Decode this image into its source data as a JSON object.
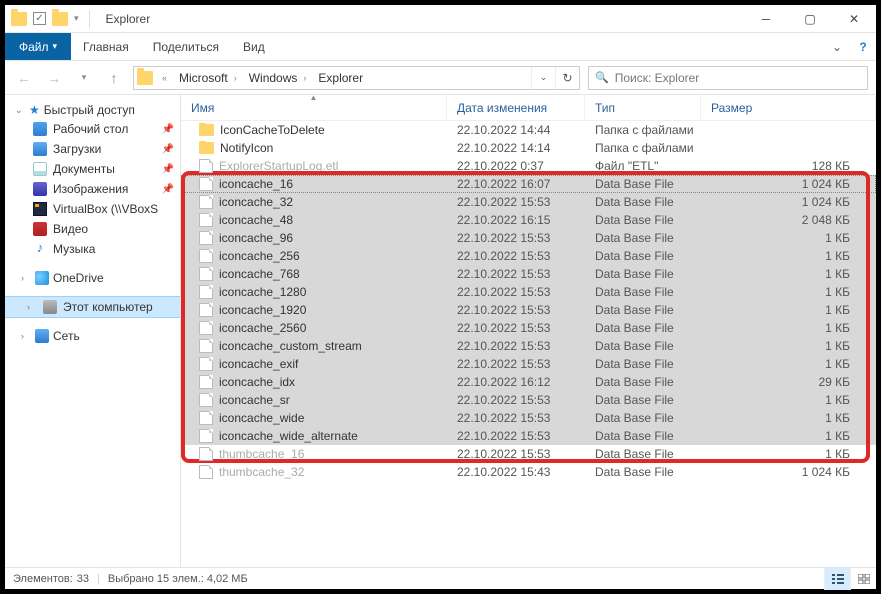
{
  "window": {
    "title": "Explorer",
    "tabs": {
      "file": "Файл",
      "home": "Главная",
      "share": "Поделиться",
      "view": "Вид"
    }
  },
  "nav": {
    "crumbs": [
      "Microsoft",
      "Windows",
      "Explorer"
    ],
    "search_placeholder": "Поиск: Explorer"
  },
  "sidebar": {
    "quick": "Быстрый доступ",
    "items": [
      {
        "label": "Рабочий стол",
        "pin": true,
        "ic": "ic-desktop"
      },
      {
        "label": "Загрузки",
        "pin": true,
        "ic": "ic-download"
      },
      {
        "label": "Документы",
        "pin": true,
        "ic": "ic-docs"
      },
      {
        "label": "Изображения",
        "pin": true,
        "ic": "ic-pics"
      },
      {
        "label": "VirtualBox (\\\\VBoxS",
        "pin": false,
        "ic": "ic-vbox"
      },
      {
        "label": "Видео",
        "pin": false,
        "ic": "ic-vid"
      },
      {
        "label": "Музыка",
        "pin": false,
        "ic": "ic-music"
      }
    ],
    "onedrive": "OneDrive",
    "thispc": "Этот компьютер",
    "network": "Сеть"
  },
  "columns": {
    "name": "Имя",
    "date": "Дата изменения",
    "type": "Тип",
    "size": "Размер"
  },
  "files": [
    {
      "name": "IconCacheToDelete",
      "date": "22.10.2022 14:44",
      "type": "Папка с файлами",
      "size": "",
      "icon": "folder",
      "selected": false
    },
    {
      "name": "NotifyIcon",
      "date": "22.10.2022 14:14",
      "type": "Папка с файлами",
      "size": "",
      "icon": "folder",
      "selected": false
    },
    {
      "name": "ExplorerStartupLog.etl",
      "date": "22.10.2022 0:37",
      "type": "Файл \"ETL\"",
      "size": "128 КБ",
      "icon": "file",
      "selected": false,
      "faded": true
    },
    {
      "name": "iconcache_16",
      "date": "22.10.2022 16:07",
      "type": "Data Base File",
      "size": "1 024 КБ",
      "icon": "file",
      "selected": true,
      "dotted": true
    },
    {
      "name": "iconcache_32",
      "date": "22.10.2022 15:53",
      "type": "Data Base File",
      "size": "1 024 КБ",
      "icon": "file",
      "selected": true
    },
    {
      "name": "iconcache_48",
      "date": "22.10.2022 16:15",
      "type": "Data Base File",
      "size": "2 048 КБ",
      "icon": "file",
      "selected": true
    },
    {
      "name": "iconcache_96",
      "date": "22.10.2022 15:53",
      "type": "Data Base File",
      "size": "1 КБ",
      "icon": "file",
      "selected": true
    },
    {
      "name": "iconcache_256",
      "date": "22.10.2022 15:53",
      "type": "Data Base File",
      "size": "1 КБ",
      "icon": "file",
      "selected": true
    },
    {
      "name": "iconcache_768",
      "date": "22.10.2022 15:53",
      "type": "Data Base File",
      "size": "1 КБ",
      "icon": "file",
      "selected": true
    },
    {
      "name": "iconcache_1280",
      "date": "22.10.2022 15:53",
      "type": "Data Base File",
      "size": "1 КБ",
      "icon": "file",
      "selected": true
    },
    {
      "name": "iconcache_1920",
      "date": "22.10.2022 15:53",
      "type": "Data Base File",
      "size": "1 КБ",
      "icon": "file",
      "selected": true
    },
    {
      "name": "iconcache_2560",
      "date": "22.10.2022 15:53",
      "type": "Data Base File",
      "size": "1 КБ",
      "icon": "file",
      "selected": true
    },
    {
      "name": "iconcache_custom_stream",
      "date": "22.10.2022 15:53",
      "type": "Data Base File",
      "size": "1 КБ",
      "icon": "file",
      "selected": true
    },
    {
      "name": "iconcache_exif",
      "date": "22.10.2022 15:53",
      "type": "Data Base File",
      "size": "1 КБ",
      "icon": "file",
      "selected": true
    },
    {
      "name": "iconcache_idx",
      "date": "22.10.2022 16:12",
      "type": "Data Base File",
      "size": "29 КБ",
      "icon": "file",
      "selected": true
    },
    {
      "name": "iconcache_sr",
      "date": "22.10.2022 15:53",
      "type": "Data Base File",
      "size": "1 КБ",
      "icon": "file",
      "selected": true
    },
    {
      "name": "iconcache_wide",
      "date": "22.10.2022 15:53",
      "type": "Data Base File",
      "size": "1 КБ",
      "icon": "file",
      "selected": true
    },
    {
      "name": "iconcache_wide_alternate",
      "date": "22.10.2022 15:53",
      "type": "Data Base File",
      "size": "1 КБ",
      "icon": "file",
      "selected": true
    },
    {
      "name": "thumbcache_16",
      "date": "22.10.2022 15:53",
      "type": "Data Base File",
      "size": "1 КБ",
      "icon": "file",
      "selected": false,
      "faded": true
    },
    {
      "name": "thumbcache_32",
      "date": "22.10.2022 15:43",
      "type": "Data Base File",
      "size": "1 024 КБ",
      "icon": "file",
      "selected": false,
      "faded": true
    }
  ],
  "status": {
    "elements_label": "Элементов:",
    "elements": "33",
    "selected": "Выбрано 15 элем.: 4,02 МБ"
  }
}
